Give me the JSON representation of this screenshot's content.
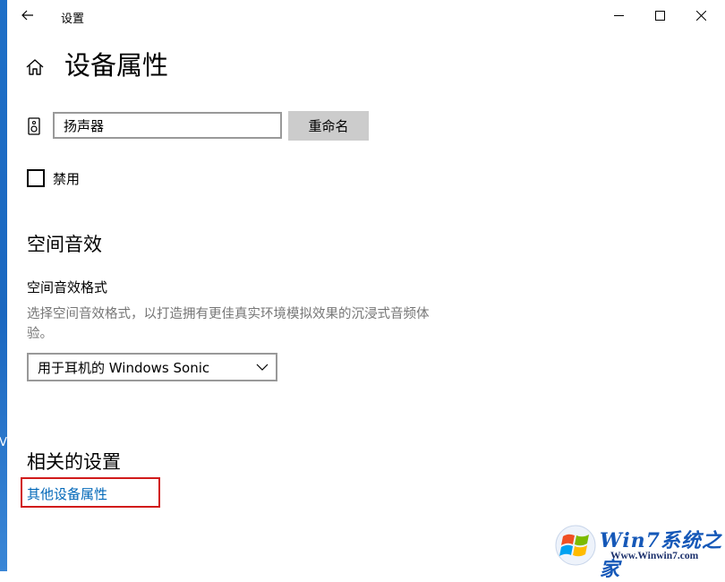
{
  "window": {
    "title": "设置",
    "page_title": "设备属性"
  },
  "desktop": {
    "edge_text": "V"
  },
  "device": {
    "name_value": "扬声器",
    "rename_label": "重命名",
    "disable_label": "禁用",
    "disable_checked": false
  },
  "spatial": {
    "section_title": "空间音效",
    "field_label": "空间音效格式",
    "description": "选择空间音效格式，以打造拥有更佳真实环境模拟效果的沉浸式音频体验。",
    "selected_option": "用于耳机的 Windows Sonic"
  },
  "related": {
    "section_title": "相关的设置",
    "link_label": "其他设备属性"
  },
  "watermark": {
    "brand": "Win7系统之家",
    "url": "Www.Winwin7.com"
  },
  "icons": {
    "back": "back-arrow-icon",
    "minimize": "minimize-icon",
    "maximize": "maximize-icon",
    "close": "close-icon",
    "home": "home-icon",
    "speaker": "speaker-icon",
    "dropdown": "chevron-down-icon"
  },
  "colors": {
    "link": "#0067b8",
    "highlight_box": "#d11a1a",
    "button_bg": "#cccccc",
    "input_border": "#999999",
    "description_text": "#767676"
  }
}
